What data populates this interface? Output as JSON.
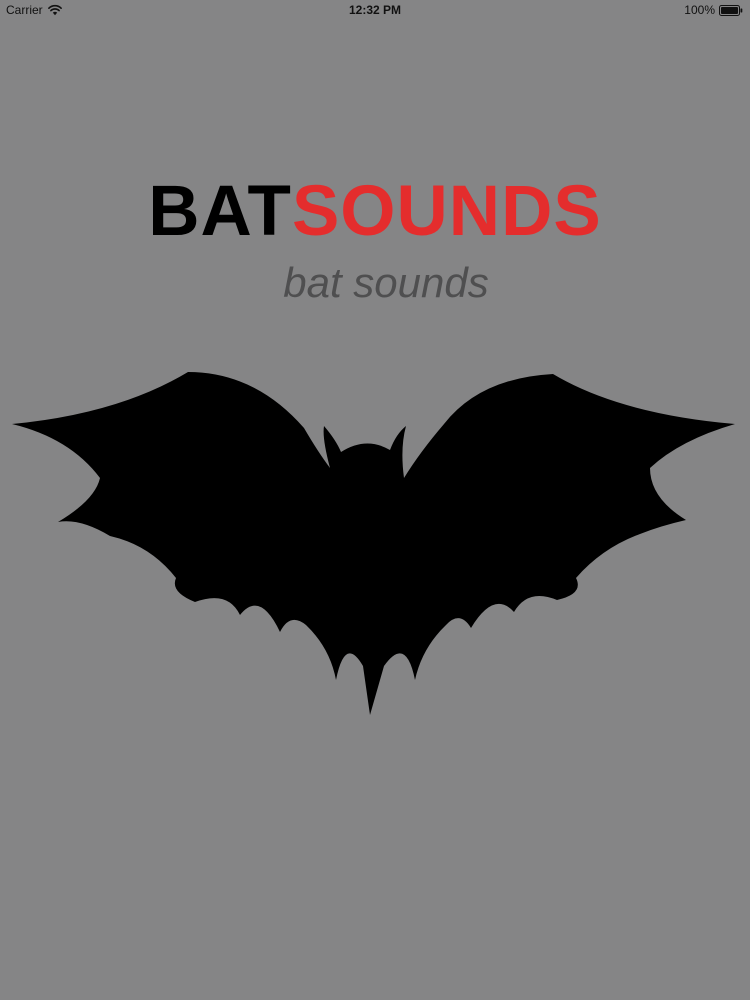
{
  "status_bar": {
    "carrier": "Carrier",
    "time": "12:32 PM",
    "battery": "100%"
  },
  "icons": {
    "wifi": "wifi-icon",
    "battery": "battery-icon",
    "bat": "bat-silhouette-icon"
  },
  "brand": {
    "title_part1": "BAT",
    "title_part2": "SOUNDS",
    "subtitle": "bat sounds"
  },
  "colors": {
    "background": "#858586",
    "title_part1": "#000000",
    "title_part2": "#e42d2d",
    "subtitle": "#4f4f50",
    "bat": "#000000"
  }
}
